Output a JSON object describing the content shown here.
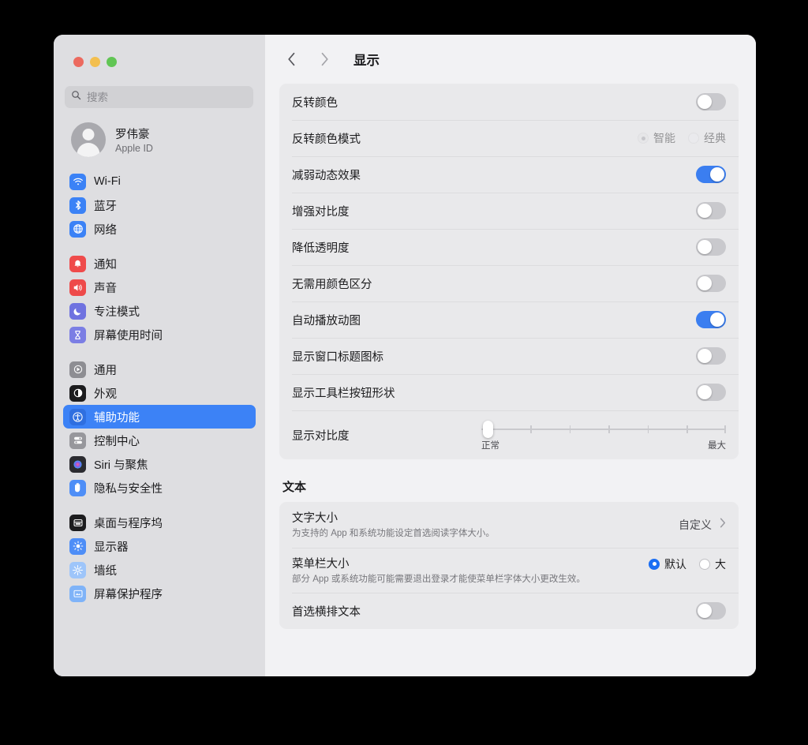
{
  "window": {
    "traffic_lights": [
      "close",
      "minimize",
      "zoom"
    ]
  },
  "sidebar": {
    "search": {
      "placeholder": "搜索",
      "value": ""
    },
    "profile": {
      "name": "罗伟豪",
      "subtitle": "Apple ID"
    },
    "groups": [
      {
        "items": [
          {
            "label": "Wi-Fi",
            "icon": "wifi-icon",
            "color": "#3b82f6",
            "selected": false
          },
          {
            "label": "蓝牙",
            "icon": "bluetooth-icon",
            "color": "#3b82f6",
            "selected": false
          },
          {
            "label": "网络",
            "icon": "globe-icon",
            "color": "#3b82f6",
            "selected": false
          }
        ]
      },
      {
        "items": [
          {
            "label": "通知",
            "icon": "bell-icon",
            "color": "#ef4b4b",
            "selected": false
          },
          {
            "label": "声音",
            "icon": "speaker-icon",
            "color": "#ee4a4a",
            "selected": false
          },
          {
            "label": "专注模式",
            "icon": "moon-icon",
            "color": "#6f72e0",
            "selected": false
          },
          {
            "label": "屏幕使用时间",
            "icon": "hourglass-icon",
            "color": "#7b7ee4",
            "selected": false
          }
        ]
      },
      {
        "items": [
          {
            "label": "通用",
            "icon": "gear-icon",
            "color": "#8e8e93",
            "selected": false
          },
          {
            "label": "外观",
            "icon": "appearance-icon",
            "color": "#1c1c1e",
            "selected": false
          },
          {
            "label": "辅助功能",
            "icon": "accessibility-icon",
            "color": "#2f6fe0",
            "selected": true
          },
          {
            "label": "控制中心",
            "icon": "control-center-icon",
            "color": "#97979c",
            "selected": false
          },
          {
            "label": "Siri 与聚焦",
            "icon": "siri-icon",
            "color": "#2b2b30",
            "selected": false
          },
          {
            "label": "隐私与安全性",
            "icon": "hand-icon",
            "color": "#4e8ef7",
            "selected": false
          }
        ]
      },
      {
        "items": [
          {
            "label": "桌面与程序坞",
            "icon": "desktop-dock-icon",
            "color": "#1c1c1e",
            "selected": false
          },
          {
            "label": "显示器",
            "icon": "brightness-icon",
            "color": "#4e8ef7",
            "selected": false
          },
          {
            "label": "墙纸",
            "icon": "wallpaper-icon",
            "color": "#7fb3f8",
            "selected": false
          },
          {
            "label": "屏幕保护程序",
            "icon": "screensaver-icon",
            "color": "#7fb3f8",
            "selected": false
          }
        ]
      }
    ]
  },
  "toolbar": {
    "back": "‹",
    "forward": "›",
    "title": "显示"
  },
  "main": {
    "display_card": [
      {
        "kind": "toggle",
        "label": "反转颜色",
        "state": "off"
      },
      {
        "kind": "radio",
        "label": "反转颜色模式",
        "disabled": true,
        "options": [
          {
            "label": "智能",
            "checked": true
          },
          {
            "label": "经典",
            "checked": false
          }
        ]
      },
      {
        "kind": "toggle",
        "label": "减弱动态效果",
        "state": "on"
      },
      {
        "kind": "toggle",
        "label": "增强对比度",
        "state": "off"
      },
      {
        "kind": "toggle",
        "label": "降低透明度",
        "state": "off"
      },
      {
        "kind": "toggle",
        "label": "无需用颜色区分",
        "state": "off"
      },
      {
        "kind": "toggle",
        "label": "自动播放动图",
        "state": "on"
      },
      {
        "kind": "toggle",
        "label": "显示窗口标题图标",
        "state": "off"
      },
      {
        "kind": "toggle",
        "label": "显示工具栏按钮形状",
        "state": "off"
      },
      {
        "kind": "slider",
        "label": "显示对比度",
        "min_label": "正常",
        "max_label": "最大",
        "value": 0,
        "ticks": 6
      }
    ],
    "text_section": {
      "title": "文本",
      "rows": [
        {
          "kind": "disclosure",
          "label": "文字大小",
          "sub": "为支持的 App 和系统功能设定首选阅读字体大小。",
          "value": "自定义",
          "chevron": "›"
        },
        {
          "kind": "radio",
          "label": "菜单栏大小",
          "sub": "部分 App 或系统功能可能需要退出登录才能使菜单栏字体大小更改生效。",
          "options": [
            {
              "label": "默认",
              "checked": true
            },
            {
              "label": "大",
              "checked": false
            }
          ]
        },
        {
          "kind": "toggle",
          "label": "首选横排文本",
          "state": "off"
        }
      ]
    }
  },
  "colors": {
    "accent": "#3b7ef0",
    "selected_sidebar": "#3c82f6",
    "window_bg": "#f2f2f4",
    "sidebar_bg": "#dedee1",
    "card_bg": "#e9e9eb"
  }
}
